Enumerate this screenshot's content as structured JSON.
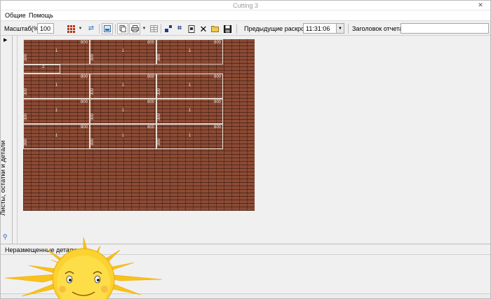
{
  "window": {
    "title": "Cutting 3"
  },
  "menu": {
    "items": [
      "Общие",
      "Помощь"
    ]
  },
  "toolbar": {
    "scale_label": "Масштаб(%)",
    "scale_value": "100",
    "previous_cuts_label": "Предыдущие раскрои",
    "previous_cuts_value": "11:31:06",
    "report_title_label": "Заголовок отчета",
    "report_title_value": "",
    "icons": [
      "grid-icon",
      "refresh-icon",
      "save-image-icon",
      "copy-icon",
      "print-icon",
      "table-icon",
      "move-icon",
      "swap-icon",
      "pin-icon",
      "delete-icon",
      "open-folder-icon",
      "floppy-save-icon"
    ]
  },
  "side_panel": {
    "label": "Листы, остатки и детали"
  },
  "bottom_panel": {
    "label": "Неразмещенные детали"
  },
  "sheet": {
    "rows": [
      [
        {
          "w": "800",
          "h": "300",
          "n": "1"
        },
        {
          "w": "800",
          "h": "300",
          "n": "1"
        },
        {
          "w": "800",
          "h": "300",
          "n": "1"
        }
      ],
      [
        {
          "w": "",
          "h": "",
          "n": "2"
        }
      ],
      [
        {
          "w": "800",
          "h": "300",
          "n": "1"
        },
        {
          "w": "800",
          "h": "300",
          "n": "1"
        },
        {
          "w": "800",
          "h": "300",
          "n": "1"
        }
      ],
      [
        {
          "w": "800",
          "h": "300",
          "n": "1"
        },
        {
          "w": "800",
          "h": "300",
          "n": "1"
        },
        {
          "w": "800",
          "h": "300",
          "n": "1"
        }
      ],
      [
        {
          "w": "800",
          "h": "300",
          "n": "1"
        },
        {
          "w": "800",
          "h": "300",
          "n": "1"
        },
        {
          "w": "800",
          "h": "300",
          "n": "1"
        }
      ]
    ]
  },
  "colors": {
    "sheet": "#8a4a34",
    "cut_line": "#e6dcd6",
    "sun": "#f7c21b"
  }
}
